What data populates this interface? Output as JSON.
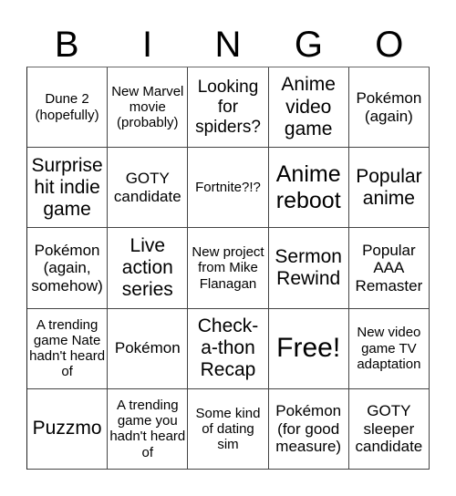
{
  "header": {
    "letters": [
      "B",
      "I",
      "N",
      "G",
      "O"
    ]
  },
  "cells": [
    [
      "Dune 2 (hopefully)",
      "New Marvel movie (probably)",
      "Looking for spiders?",
      "Anime video game",
      "Pokémon (again)"
    ],
    [
      "Surprise hit indie game",
      "GOTY candidate",
      "Fortnite?!?",
      "Anime reboot",
      "Popular anime"
    ],
    [
      "Pokémon (again, somehow)",
      "Live action series",
      "New project from Mike Flanagan",
      "Sermon Rewind",
      "Popular AAA Remaster"
    ],
    [
      "A trending game Nate hadn't heard of",
      "Pokémon",
      "Check-a-thon Recap",
      "Free!",
      "New video game TV adaptation"
    ],
    [
      "Puzzmo",
      "A trending game you hadn't heard of",
      "Some kind of dating sim",
      "Pokémon (for good measure)",
      "GOTY sleeper candidate"
    ]
  ]
}
